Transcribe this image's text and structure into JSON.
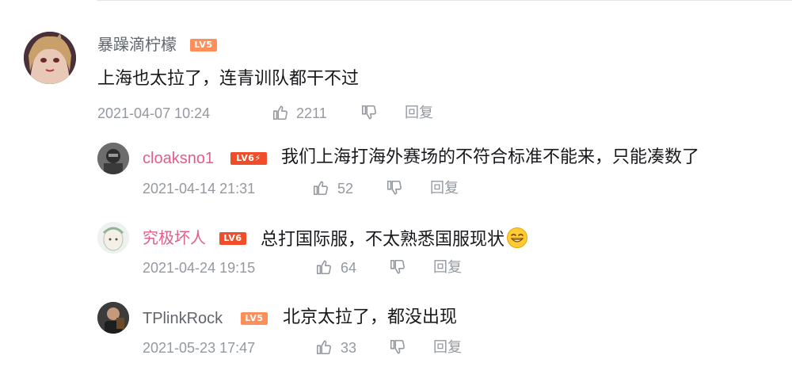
{
  "colors": {
    "accent_pink": "#e05f8a",
    "meta_gray": "#9499a0",
    "level_orange": "#ff8f5a",
    "level_red": "#f04d2a"
  },
  "comments": [
    {
      "username": "暴躁滴柠檬",
      "level": "LV5",
      "content": "上海也太拉了，连青训队都干不过",
      "date": "2021-04-07 10:24",
      "likes": "2211",
      "reply_label": "回复"
    }
  ],
  "replies": [
    {
      "username": "cloaksno1",
      "level": "LV6⚡",
      "content": "我们上海打海外赛场的不符合标准不能来，只能凑数了",
      "date": "2021-04-14 21:31",
      "likes": "52",
      "reply_label": "回复"
    },
    {
      "username": "究极坏人",
      "level": "LV6",
      "content": "总打国际服，不太熟悉国服现状",
      "emoji": "grinning-emoji",
      "date": "2021-04-24 19:15",
      "likes": "64",
      "reply_label": "回复"
    },
    {
      "username": "TPlinkRock",
      "level": "LV5",
      "content": "北京太拉了，都没出现",
      "date": "2021-05-23 17:47",
      "likes": "33",
      "reply_label": "回复"
    }
  ]
}
